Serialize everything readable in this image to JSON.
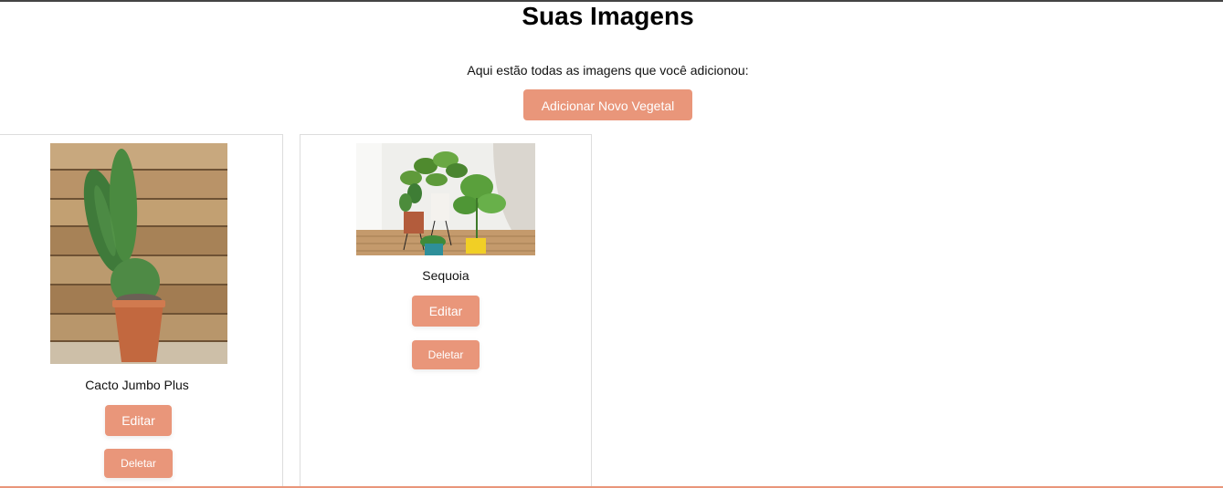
{
  "page": {
    "title": "Suas Imagens",
    "intro": "Aqui estão todas as imagens que você adicionou:",
    "add_button_label": "Adicionar Novo Vegetal",
    "accent_color": "#e9967a"
  },
  "plants": [
    {
      "name": "Cacto Jumbo Plus",
      "image": "cactus-photo",
      "edit_label": "Editar",
      "delete_label": "Deletar"
    },
    {
      "name": "Sequoia",
      "image": "potted-plants-photo",
      "edit_label": "Editar",
      "delete_label": "Deletar"
    }
  ]
}
